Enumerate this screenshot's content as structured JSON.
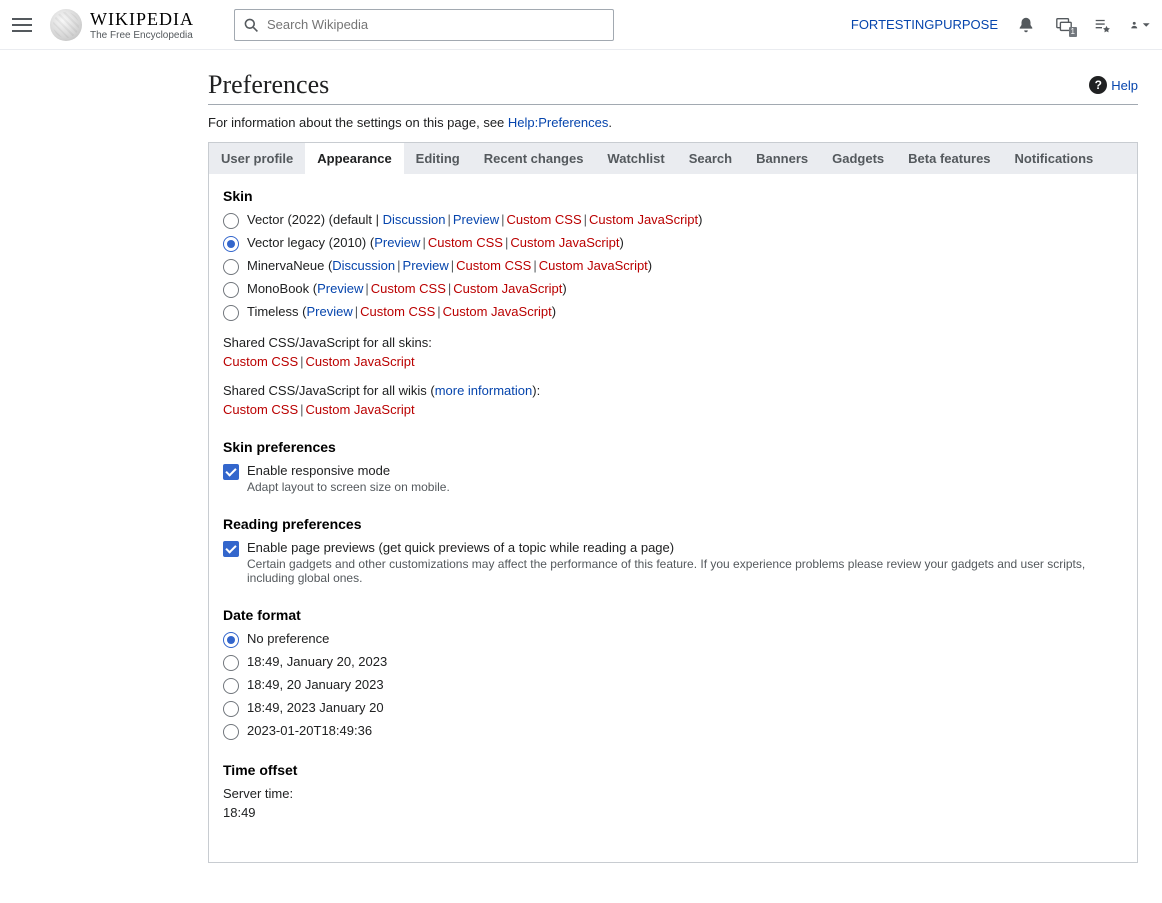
{
  "header": {
    "logo_word": "Wikipedia",
    "logo_sub": "The Free Encyclopedia",
    "search_placeholder": "Search Wikipedia",
    "username": "FORTESTINGPURPOSE",
    "talk_badge": "1"
  },
  "page": {
    "title": "Preferences",
    "help_label": "Help",
    "intro_prefix": "For information about the settings on this page, see ",
    "intro_link": "Help:Preferences",
    "intro_suffix": "."
  },
  "tabs": [
    "User profile",
    "Appearance",
    "Editing",
    "Recent changes",
    "Watchlist",
    "Search",
    "Banners",
    "Gadgets",
    "Beta features",
    "Notifications"
  ],
  "active_tab": "Appearance",
  "skin": {
    "heading": "Skin",
    "options": [
      {
        "label": "Vector (2022)",
        "suffix_open": " (default | ",
        "links": [
          {
            "t": "Discussion",
            "r": false
          },
          {
            "t": "Preview",
            "r": false
          },
          {
            "t": "Custom CSS",
            "r": true
          },
          {
            "t": "Custom JavaScript",
            "r": true
          }
        ],
        "checked": false
      },
      {
        "label": "Vector legacy (2010)",
        "suffix_open": " (",
        "links": [
          {
            "t": "Preview",
            "r": false
          },
          {
            "t": "Custom CSS",
            "r": true
          },
          {
            "t": "Custom JavaScript",
            "r": true
          }
        ],
        "checked": true
      },
      {
        "label": "MinervaNeue",
        "suffix_open": " (",
        "links": [
          {
            "t": "Discussion",
            "r": false
          },
          {
            "t": "Preview",
            "r": false
          },
          {
            "t": "Custom CSS",
            "r": true
          },
          {
            "t": "Custom JavaScript",
            "r": true
          }
        ],
        "checked": false
      },
      {
        "label": "MonoBook",
        "suffix_open": " (",
        "links": [
          {
            "t": "Preview",
            "r": false
          },
          {
            "t": "Custom CSS",
            "r": true
          },
          {
            "t": "Custom JavaScript",
            "r": true
          }
        ],
        "checked": false
      },
      {
        "label": "Timeless",
        "suffix_open": " (",
        "links": [
          {
            "t": "Preview",
            "r": false
          },
          {
            "t": "Custom CSS",
            "r": true
          },
          {
            "t": "Custom JavaScript",
            "r": true
          }
        ],
        "checked": false
      }
    ],
    "shared_skins_label": "Shared CSS/JavaScript for all skins:",
    "shared_wikis_prefix": "Shared CSS/JavaScript for all wikis (",
    "shared_wikis_link": "more information",
    "shared_wikis_suffix": "):",
    "custom_css": "Custom CSS",
    "custom_js": "Custom JavaScript"
  },
  "skin_prefs": {
    "heading": "Skin preferences",
    "cb_label": "Enable responsive mode",
    "cb_hint": "Adapt layout to screen size on mobile."
  },
  "reading": {
    "heading": "Reading preferences",
    "cb_label": "Enable page previews (get quick previews of a topic while reading a page)",
    "cb_hint": "Certain gadgets and other customizations may affect the performance of this feature. If you experience problems please review your gadgets and user scripts, including global ones."
  },
  "date": {
    "heading": "Date format",
    "options": [
      "No preference",
      "18:49, January 20, 2023",
      "18:49, 20 January 2023",
      "18:49, 2023 January 20",
      "2023-01-20T18:49:36"
    ],
    "checked_index": 0
  },
  "time": {
    "heading": "Time offset",
    "server_label": "Server time:",
    "server_value": "18:49"
  }
}
